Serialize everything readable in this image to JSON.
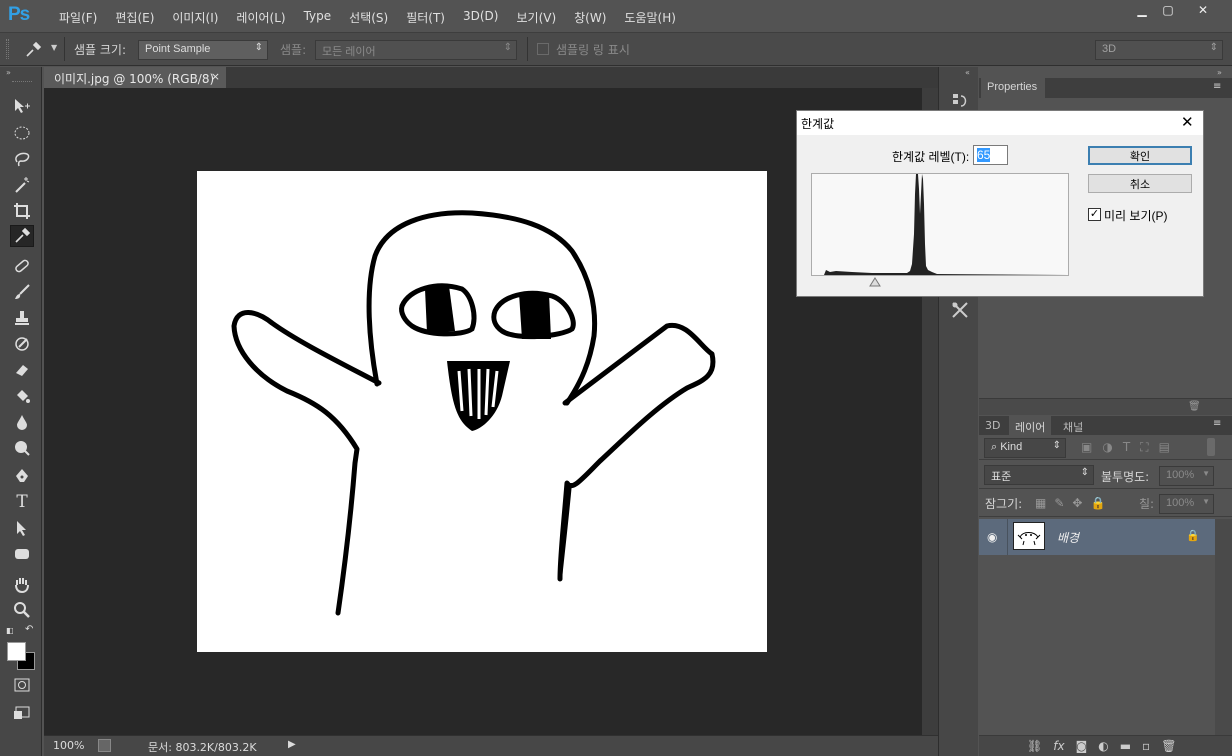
{
  "app": {
    "logo": "Ps"
  },
  "menu": [
    "파일(F)",
    "편집(E)",
    "이미지(I)",
    "레이어(L)",
    "Type",
    "선택(S)",
    "필터(T)",
    "3D(D)",
    "보기(V)",
    "창(W)",
    "도움말(H)"
  ],
  "window_controls": {
    "minimize": "▁",
    "maximize": "▢",
    "close": "✕"
  },
  "options": {
    "sample_size_label": "샘플 크기:",
    "sample_size_value": "Point Sample",
    "sample_label": "샘플:",
    "sample_value": "모든 레이어",
    "show_ring_label": "샘플링 링 표시",
    "workspace": "3D"
  },
  "document": {
    "tab_title": "이미지.jpg @ 100% (RGB/8)",
    "tab_close": "×"
  },
  "status": {
    "zoom": "100%",
    "doc_info": "문서: 803.2K/803.2K"
  },
  "properties_panel": {
    "title": "Properties"
  },
  "layers_panel": {
    "tabs": [
      "3D",
      "레이어",
      "채널"
    ],
    "filter_kind": "Kind",
    "blend_mode": "표준",
    "opacity_label": "불투명도:",
    "opacity_value": "100%",
    "lock_label": "잠그기:",
    "fill_label": "칠:",
    "fill_value": "100%",
    "layers": [
      {
        "name": "배경",
        "visible": true,
        "locked": true
      }
    ]
  },
  "threshold_dialog": {
    "title": "한계값",
    "level_label": "한계값 레벨(T):",
    "level_value": "65",
    "ok": "확인",
    "cancel": "취소",
    "preview_label": "미리 보기(P)",
    "preview_checked": true,
    "close": "✕"
  }
}
